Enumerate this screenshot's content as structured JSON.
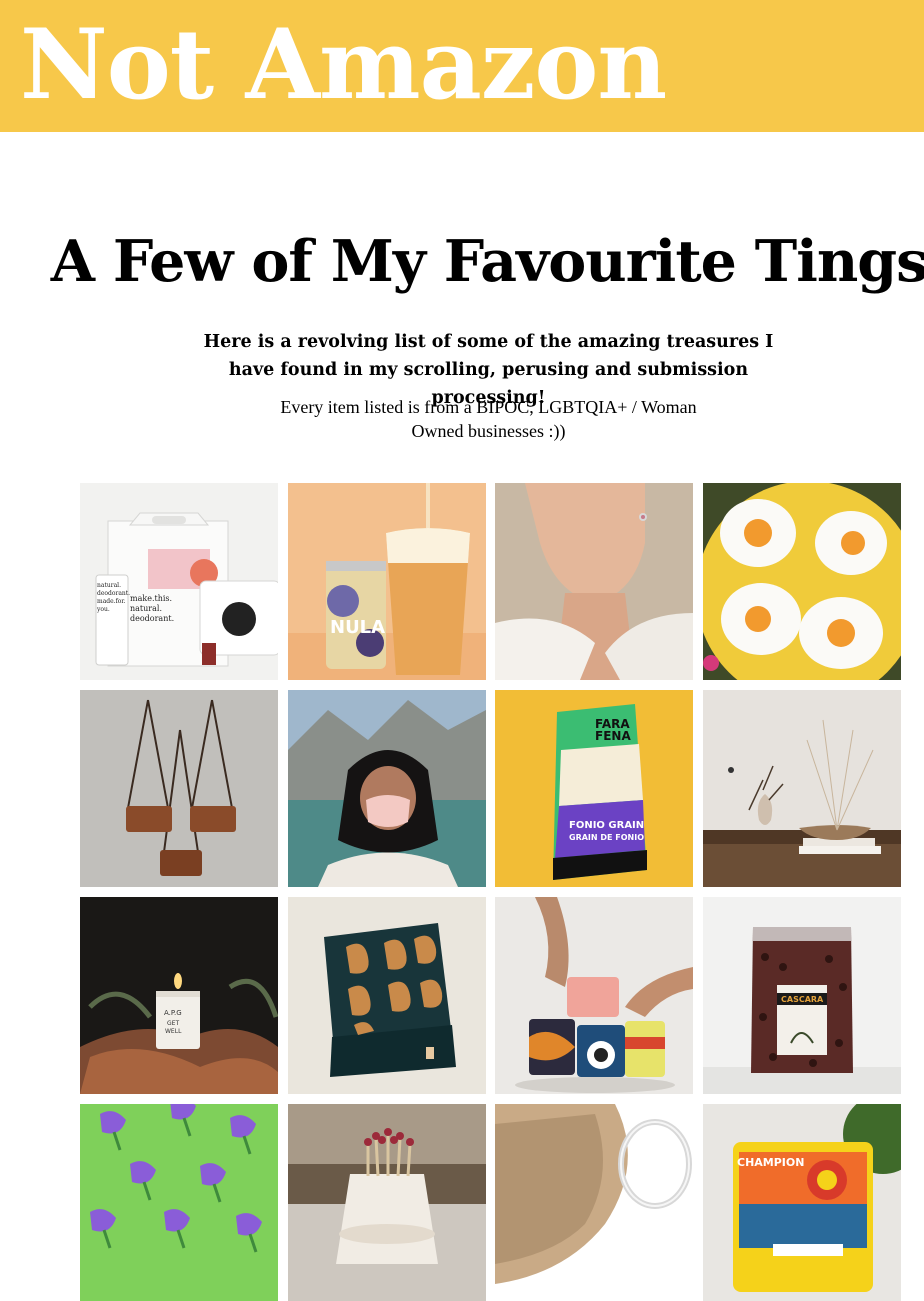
{
  "header": {
    "brand": "Not Amazon",
    "background_color": "#f7c84a"
  },
  "main": {
    "title": "A Few of My Favourite Tings",
    "intro": "Here is a revolving list of some of the amazing treasures I have found in my scrolling, perusing and submission processing!",
    "subintro": "Every item listed is from a BIPOC, LGBTQIA+ / Woman Owned businesses :))"
  },
  "products": [
    {
      "name": "deodorant",
      "texts": [
        "natural.",
        "deodorant.",
        "made.for.",
        "you.",
        "make.this.",
        "natural.",
        "deodorant."
      ]
    },
    {
      "name": "nula-beer",
      "texts": [
        "NULA"
      ]
    },
    {
      "name": "earrings-portrait",
      "texts": []
    },
    {
      "name": "egg-rugs",
      "texts": []
    },
    {
      "name": "leather-crossbody-bags",
      "texts": []
    },
    {
      "name": "face-mask",
      "texts": []
    },
    {
      "name": "fonio-grain",
      "texts": [
        "FARA",
        "FENA",
        "FONIO GRAIN",
        "GRAIN DE FONIO"
      ]
    },
    {
      "name": "ceramic-vases",
      "texts": []
    },
    {
      "name": "candle",
      "texts": [
        "A.P.G",
        "GET",
        "WELL"
      ]
    },
    {
      "name": "gift-box",
      "texts": []
    },
    {
      "name": "soap-bars",
      "texts": []
    },
    {
      "name": "cascara-tea",
      "texts": [
        "CASCARA"
      ]
    },
    {
      "name": "lilac-stickers",
      "texts": []
    },
    {
      "name": "match-holder",
      "texts": []
    },
    {
      "name": "fur-hoop-earring",
      "texts": []
    },
    {
      "name": "racing-game",
      "texts": [
        "CHAMPION"
      ]
    }
  ]
}
